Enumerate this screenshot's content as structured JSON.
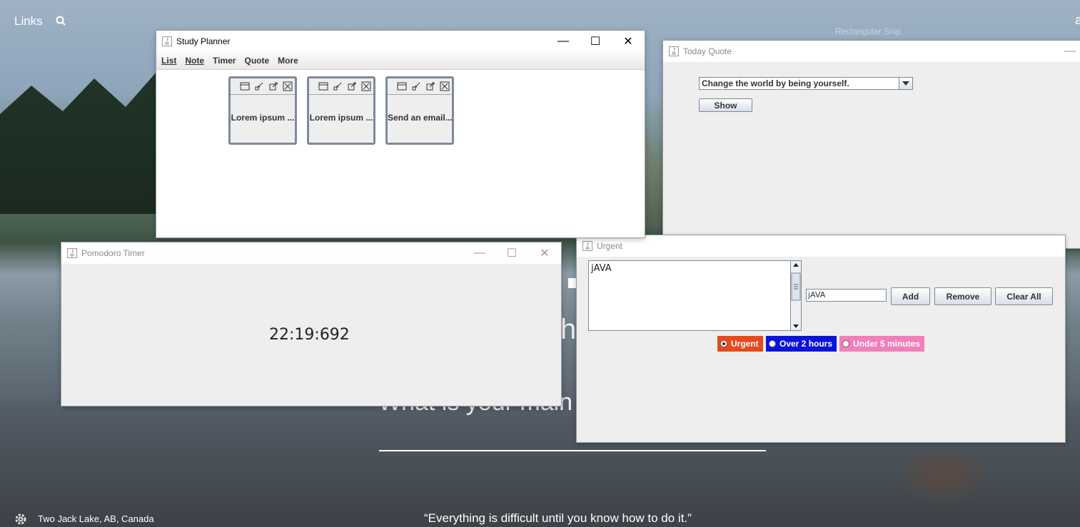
{
  "desktop": {
    "links_label": "Links",
    "snip_label": "Rectangular Snip",
    "corner_char": "a",
    "clock_text": "What is your main",
    "focus_partial": "hi",
    "quote": "“Everything is difficult until you know how to do it.”",
    "location": "Two Jack Lake, AB, Canada"
  },
  "study_planner": {
    "title": "Study Planner",
    "menu": [
      "List",
      "Note",
      "Timer",
      "Quote",
      "More"
    ],
    "notes": [
      "Lorem ipsum ...",
      "Lorem ipsum ...",
      "Send an email..."
    ]
  },
  "today_quote": {
    "title": "Today Quote",
    "selected_quote": "Change the world by being yourself.",
    "show_label": "Show"
  },
  "pomodoro": {
    "title": "Pomodoro Timer",
    "time": "22:19:692"
  },
  "urgent": {
    "title": "Urgent",
    "textarea_value": "jAVA",
    "input_value": "jAVA",
    "add_label": "Add",
    "remove_label": "Remove",
    "clear_label": "Clear All",
    "radios": [
      {
        "label": "Urgent",
        "color": "#e8491b",
        "selected": true
      },
      {
        "label": "Over 2 hours",
        "color": "#0a14d8",
        "selected": false
      },
      {
        "label": "Under 5 minutes",
        "color": "#f07fba",
        "selected": false
      }
    ]
  },
  "window_controls": {
    "minimize": "—",
    "maximize": "☐",
    "close": "✕"
  }
}
